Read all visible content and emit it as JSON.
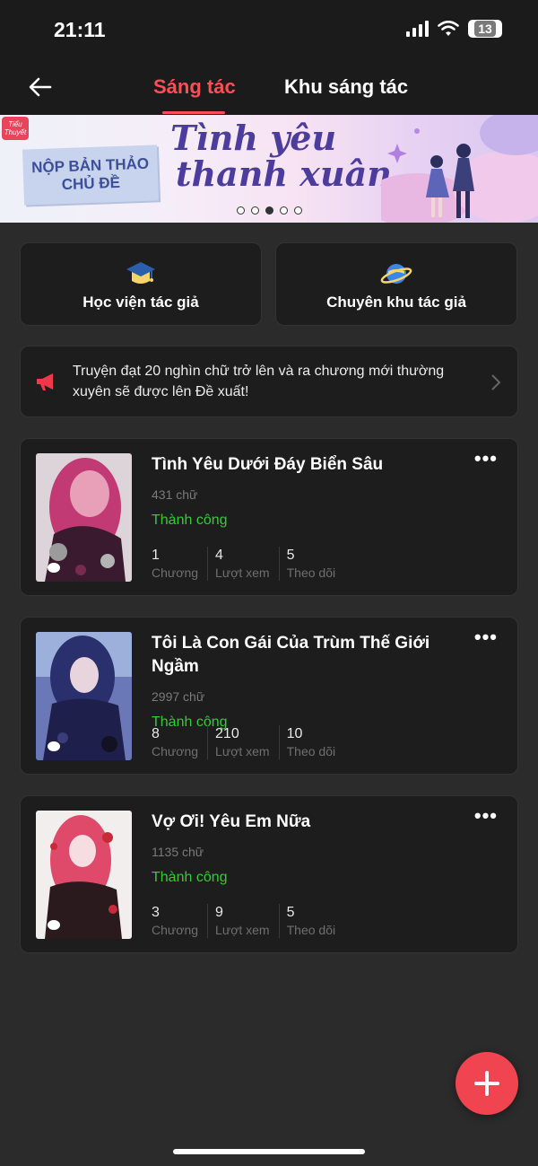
{
  "status_bar": {
    "time": "21:11",
    "battery": "13"
  },
  "header": {
    "tabs": [
      {
        "label": "Sáng tác",
        "active": true
      },
      {
        "label": "Khu sáng tác",
        "active": false
      }
    ],
    "accent": "#ff4d55"
  },
  "banner": {
    "badge": "Tiểu Thuyết",
    "submit_line1": "NỘP BẢN THẢO",
    "submit_line2": "CHỦ ĐỀ",
    "title_line1": "Tình yêu",
    "title_line2": "thanh xuân",
    "dots_count": 5,
    "active_dot": 2
  },
  "quick_actions": [
    {
      "label": "Học viện tác giả",
      "icon": "graduation-cap-icon"
    },
    {
      "label": "Chuyên khu tác giả",
      "icon": "planet-icon"
    }
  ],
  "notice": {
    "text": "Truyện đạt 20 nghìn chữ trở lên và ra chương mới thường xuyên sẽ được lên Đề xuất!",
    "icon": "megaphone-icon"
  },
  "stories": [
    {
      "title": "Tình Yêu Dưới Đáy Biển Sâu",
      "words": "431 chữ",
      "status": "Thành công",
      "chapters": "1",
      "chapters_label": "Chương",
      "views": "4",
      "views_label": "Lượt xem",
      "follows": "5",
      "follows_label": "Theo dõi"
    },
    {
      "title": "Tôi Là Con Gái Của Trùm Thế Giới Ngầm",
      "words": "2997 chữ",
      "status": "Thành công",
      "chapters": "8",
      "chapters_label": "Chương",
      "views": "210",
      "views_label": "Lượt xem",
      "follows": "10",
      "follows_label": "Theo dõi"
    },
    {
      "title": "Vợ Ơi! Yêu Em Nữa",
      "words": "1135 chữ",
      "status": "Thành công",
      "chapters": "3",
      "chapters_label": "Chương",
      "views": "9",
      "views_label": "Lượt xem",
      "follows": "5",
      "follows_label": "Theo dõi"
    }
  ],
  "colors": {
    "success": "#33cc33",
    "fab": "#f04451",
    "background": "#2b2b2b",
    "card": "#1d1d1d"
  }
}
